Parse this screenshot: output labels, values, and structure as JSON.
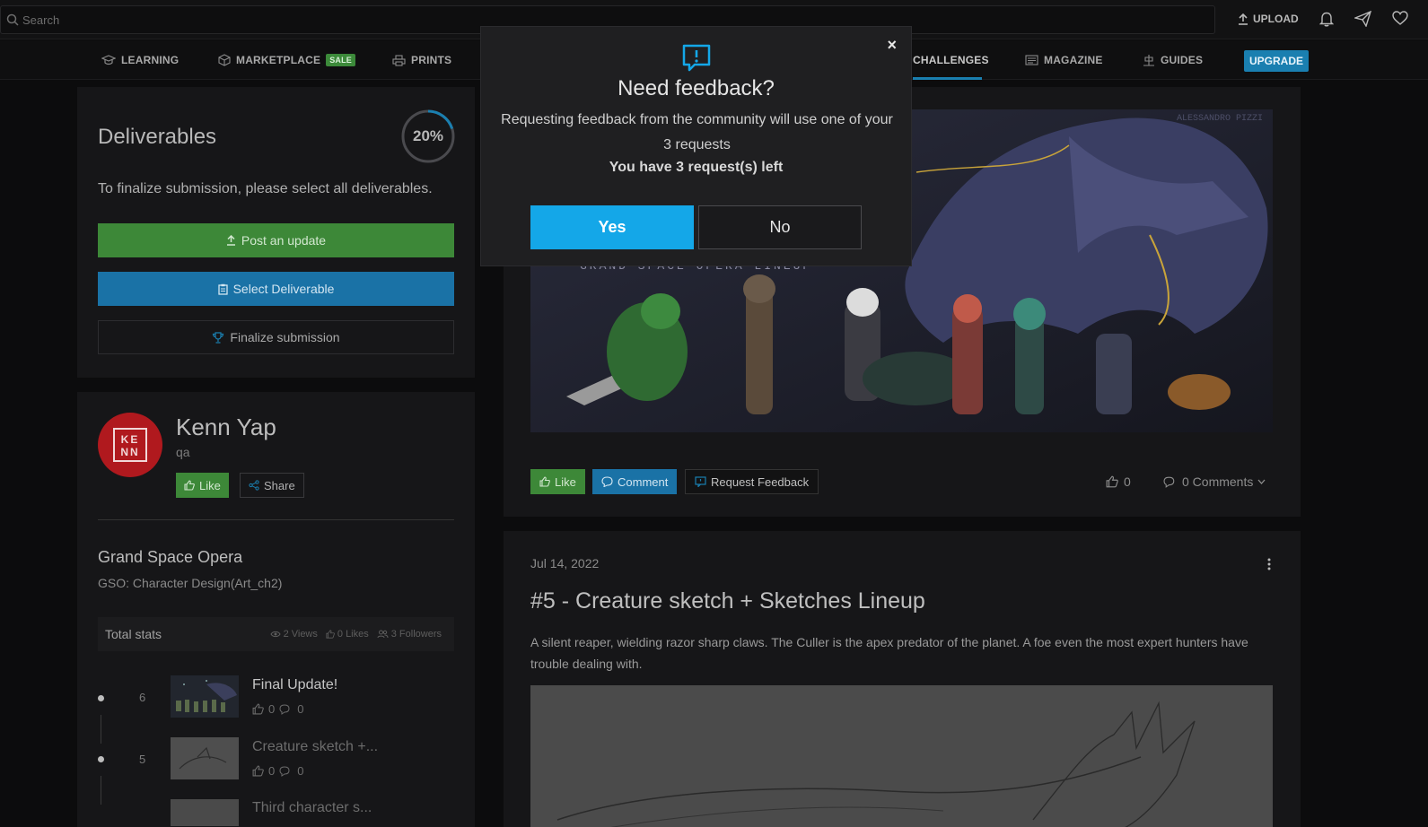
{
  "topbar": {
    "search_placeholder": "Search",
    "upload_label": "UPLOAD",
    "icons": [
      "upload-icon",
      "bell-icon",
      "paper-plane-icon",
      "heart-icon"
    ]
  },
  "nav": {
    "items": [
      {
        "label": "LEARNING",
        "icon": "graduation-cap-icon"
      },
      {
        "label": "MARKETPLACE",
        "icon": "box-icon",
        "badge": "SALE"
      },
      {
        "label": "PRINTS",
        "icon": "print-icon"
      },
      {
        "label": "CHALLENGES",
        "icon": "",
        "active": true
      },
      {
        "label": "MAGAZINE",
        "icon": "newspaper-icon"
      },
      {
        "label": "GUIDES",
        "icon": "guide-icon"
      }
    ],
    "upgrade_label": "UPGRADE",
    "accent": "#1a7fb0"
  },
  "deliverables": {
    "title": "Deliverables",
    "progress": "20%",
    "progress_fraction": 0.2,
    "note": "To finalize submission, please select all deliverables.",
    "post_update": "Post an update",
    "select_deliverable": "Select Deliverable",
    "finalize": "Finalize submission"
  },
  "profile": {
    "avatar_text": "KENN",
    "name": "Kenn Yap",
    "role": "qa",
    "like": "Like",
    "share": "Share",
    "challenge_title": "Grand Space Opera",
    "challenge_sub": "GSO: Character Design(Art_ch2)",
    "stats_label": "Total stats",
    "views": "2 Views",
    "likes": "0 Likes",
    "followers": "3 Followers"
  },
  "timeline": [
    {
      "num": "6",
      "title": "Final Update!",
      "likes": "0",
      "comments": "0"
    },
    {
      "num": "5",
      "title": "Creature sketch +...",
      "likes": "0",
      "comments": "0"
    },
    {
      "title": "Third character s..."
    }
  ],
  "post1": {
    "like": "Like",
    "comment": "Comment",
    "request_feedback": "Request Feedback",
    "likes_count": "0",
    "comments_count": "0 Comments",
    "art_caption": "GRAND SPACE OPERA LINEUP",
    "art_watermark": "ALESSANDRO PIZZI"
  },
  "post2": {
    "date": "Jul 14, 2022",
    "title": "#5 - Creature sketch + Sketches Lineup",
    "description": "A silent reaper, wielding razor sharp claws. The Culler is the apex predator of the planet. A foe even the most expert hunters have trouble dealing with."
  },
  "modal": {
    "title": "Need feedback?",
    "message": "Requesting feedback from the community will use one of your 3 requests",
    "requests_left": "You have 3 request(s) left",
    "yes": "Yes",
    "no": "No",
    "close": "×",
    "yes_color": "#14a7e8"
  }
}
